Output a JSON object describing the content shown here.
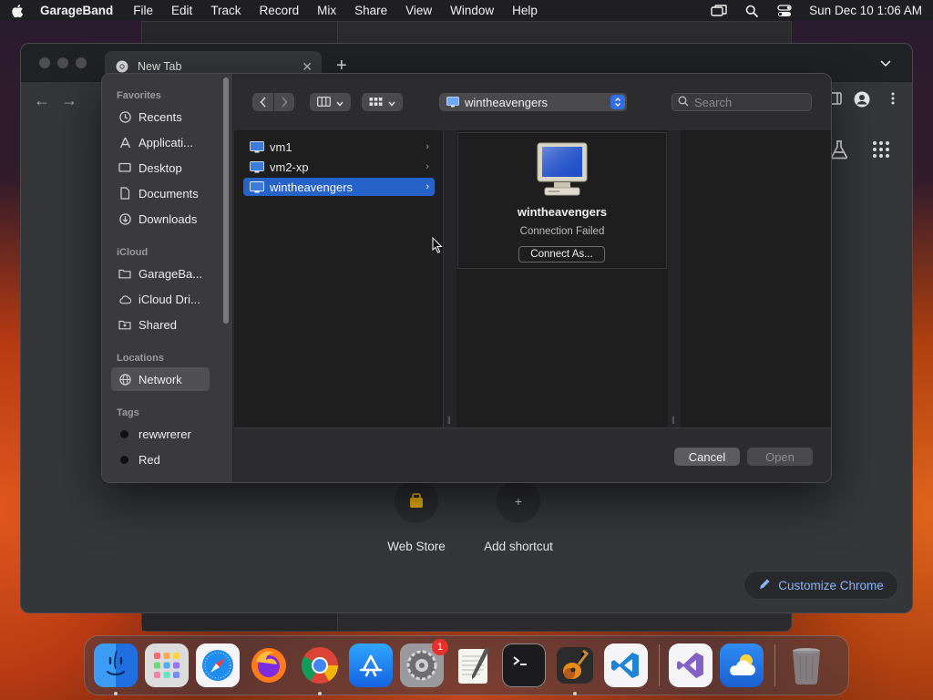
{
  "menubar": {
    "app": "GarageBand",
    "items": [
      "File",
      "Edit",
      "Track",
      "Record",
      "Mix",
      "Share",
      "View",
      "Window",
      "Help"
    ],
    "clock": "Sun Dec 10  1:06 AM"
  },
  "chrome": {
    "tab_title": "New Tab",
    "shortcuts": [
      "Web Store",
      "Add shortcut"
    ],
    "customize_label": "Customize Chrome"
  },
  "dialog": {
    "location": "wintheavengers",
    "search_placeholder": "Search",
    "sidebar": {
      "favorites_header": "Favorites",
      "favorites": [
        "Recents",
        "Applicati...",
        "Desktop",
        "Documents",
        "Downloads"
      ],
      "icloud_header": "iCloud",
      "icloud": [
        "GarageBa...",
        "iCloud Dri...",
        "Shared"
      ],
      "locations_header": "Locations",
      "locations": [
        "Network"
      ],
      "tags_header": "Tags",
      "tags": [
        "rewwrerer",
        "Red"
      ]
    },
    "rows": [
      "vm1",
      "vm2-xp",
      "wintheavengers"
    ],
    "preview": {
      "name": "wintheavengers",
      "status": "Connection Failed",
      "button": "Connect As..."
    },
    "cancel_label": "Cancel",
    "open_label": "Open"
  },
  "dock": {
    "settings_badge": "1"
  },
  "colors": {
    "selection": "#2563c9",
    "accent_link": "#8ab4f8",
    "badge": "#e5322d"
  }
}
